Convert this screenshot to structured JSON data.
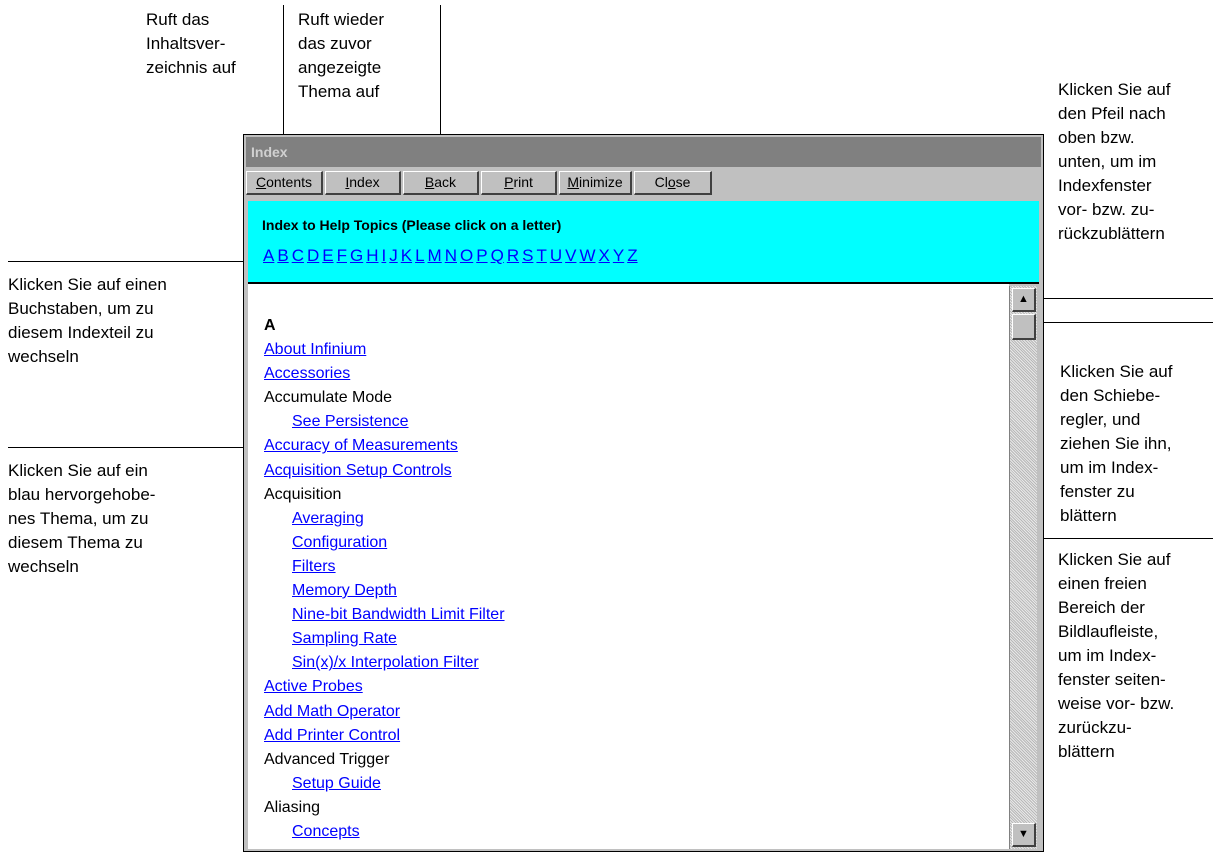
{
  "annotations": {
    "contents_note": "Ruft das\nInhaltsver-\nzeichnis auf",
    "back_note": "Ruft wieder\ndas zuvor\nangezeigte\nThema auf",
    "scroll_arrow_note": "Klicken Sie auf\nden Pfeil nach\noben bzw.\nunten, um im\nIndexfenster\nvor- bzw. zu-\nrückzublättern",
    "letter_note": "Klicken Sie auf einen\nBuchstaben, um zu\ndiesem Indexteil zu\nwechseln",
    "topic_note": "Klicken Sie auf ein\nblau hervorgehobe-\nnes Thema, um zu\ndiesem Thema zu\nwechseln",
    "thumb_note": "Klicken Sie auf\nden Schiebe-\nregler, und\nziehen Sie ihn,\num im Index-\nfenster zu\nblättern",
    "track_note": "Klicken Sie auf\neinen freien\nBereich der\nBildlaufleiste,\num im Index-\nfenster seiten-\nweise vor- bzw.\nzurückzu-\nblättern"
  },
  "window": {
    "title": "Index",
    "toolbar": [
      {
        "key": "C",
        "rest": "ontents"
      },
      {
        "key": "I",
        "rest": "ndex"
      },
      {
        "key": "B",
        "rest": "ack"
      },
      {
        "key": "P",
        "rest": "rint"
      },
      {
        "key": "M",
        "rest": "inimize"
      },
      {
        "pre": "Cl",
        "key": "o",
        "rest": "se"
      }
    ],
    "banner_title": "Index to Help Topics  (Please click on a letter)",
    "letters": [
      "A",
      "B",
      "C",
      "D",
      "E",
      "F",
      "G",
      "H",
      "I",
      "J",
      "K",
      "L",
      "M",
      "N",
      "O",
      "P",
      "Q",
      "R",
      "S",
      "T",
      "U",
      "V",
      "W",
      "X",
      "Y",
      "Z"
    ],
    "list": [
      {
        "text": "A",
        "kind": "heading",
        "level": 0
      },
      {
        "text": "About Infinium",
        "kind": "link",
        "level": 0
      },
      {
        "text": "Accessories",
        "kind": "link",
        "level": 0
      },
      {
        "text": "Accumulate Mode",
        "kind": "plain",
        "level": 0
      },
      {
        "text": "See Persistence",
        "kind": "link",
        "level": 1
      },
      {
        "text": "Accuracy of Measurements",
        "kind": "link",
        "level": 0
      },
      {
        "text": "Acquisition Setup Controls",
        "kind": "link",
        "level": 0
      },
      {
        "text": "Acquisition",
        "kind": "plain",
        "level": 0
      },
      {
        "text": "Averaging",
        "kind": "link",
        "level": 1
      },
      {
        "text": "Configuration",
        "kind": "link",
        "level": 1
      },
      {
        "text": "Filters",
        "kind": "link",
        "level": 1
      },
      {
        "text": "Memory Depth",
        "kind": "link",
        "level": 1
      },
      {
        "text": "Nine-bit Bandwidth Limit Filter",
        "kind": "link",
        "level": 1
      },
      {
        "text": "Sampling Rate",
        "kind": "link",
        "level": 1
      },
      {
        "text": "Sin(x)/x Interpolation Filter",
        "kind": "link",
        "level": 1
      },
      {
        "text": "Active Probes",
        "kind": "link",
        "level": 0
      },
      {
        "text": "Add Math Operator",
        "kind": "link",
        "level": 0
      },
      {
        "text": "Add Printer Control",
        "kind": "link",
        "level": 0
      },
      {
        "text": "Advanced Trigger",
        "kind": "plain",
        "level": 0
      },
      {
        "text": "Setup Guide",
        "kind": "link",
        "level": 1
      },
      {
        "text": "Aliasing",
        "kind": "plain",
        "level": 0
      },
      {
        "text": "Concepts",
        "kind": "link",
        "level": 1
      }
    ],
    "scrollbar": {
      "up_icon": "scroll-up-arrow-icon",
      "down_icon": "scroll-down-arrow-icon",
      "position": 0
    }
  }
}
